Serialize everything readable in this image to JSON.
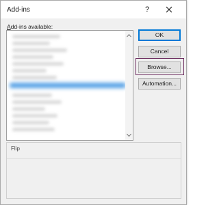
{
  "dialog": {
    "title": "Add-ins",
    "help_label": "?",
    "list_label": "Add-ins available:",
    "list_label_accel": "A",
    "list_label_rest": "dd-ins available:",
    "description_title": "Flip"
  },
  "buttons": {
    "ok": "OK",
    "cancel": "Cancel",
    "browse": "Browse...",
    "automation": "Automation..."
  },
  "colors": {
    "selection": "#5aa3e6",
    "highlight_box": "#6b2b5e",
    "default_button_border": "#0078d7"
  },
  "icons": {
    "close": "close-icon",
    "scroll_up": "chevron-up-icon",
    "scroll_down": "chevron-down-icon"
  }
}
